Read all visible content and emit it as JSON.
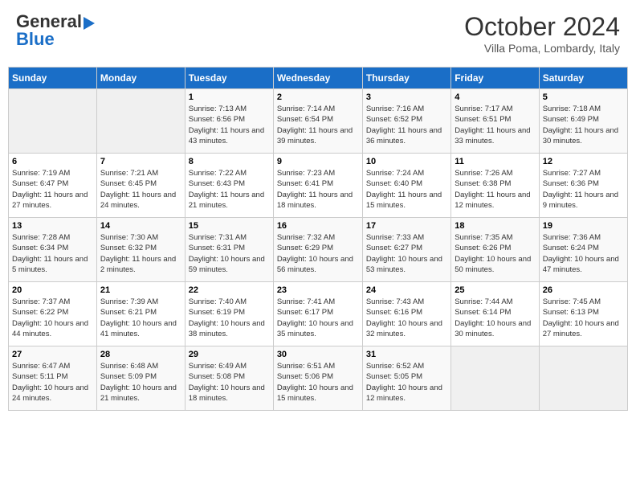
{
  "header": {
    "logo_line1": "General",
    "logo_line2": "Blue",
    "month": "October 2024",
    "location": "Villa Poma, Lombardy, Italy"
  },
  "days_of_week": [
    "Sunday",
    "Monday",
    "Tuesday",
    "Wednesday",
    "Thursday",
    "Friday",
    "Saturday"
  ],
  "weeks": [
    [
      {
        "day": "",
        "info": ""
      },
      {
        "day": "",
        "info": ""
      },
      {
        "day": "1",
        "info": "Sunrise: 7:13 AM\nSunset: 6:56 PM\nDaylight: 11 hours and 43 minutes."
      },
      {
        "day": "2",
        "info": "Sunrise: 7:14 AM\nSunset: 6:54 PM\nDaylight: 11 hours and 39 minutes."
      },
      {
        "day": "3",
        "info": "Sunrise: 7:16 AM\nSunset: 6:52 PM\nDaylight: 11 hours and 36 minutes."
      },
      {
        "day": "4",
        "info": "Sunrise: 7:17 AM\nSunset: 6:51 PM\nDaylight: 11 hours and 33 minutes."
      },
      {
        "day": "5",
        "info": "Sunrise: 7:18 AM\nSunset: 6:49 PM\nDaylight: 11 hours and 30 minutes."
      }
    ],
    [
      {
        "day": "6",
        "info": "Sunrise: 7:19 AM\nSunset: 6:47 PM\nDaylight: 11 hours and 27 minutes."
      },
      {
        "day": "7",
        "info": "Sunrise: 7:21 AM\nSunset: 6:45 PM\nDaylight: 11 hours and 24 minutes."
      },
      {
        "day": "8",
        "info": "Sunrise: 7:22 AM\nSunset: 6:43 PM\nDaylight: 11 hours and 21 minutes."
      },
      {
        "day": "9",
        "info": "Sunrise: 7:23 AM\nSunset: 6:41 PM\nDaylight: 11 hours and 18 minutes."
      },
      {
        "day": "10",
        "info": "Sunrise: 7:24 AM\nSunset: 6:40 PM\nDaylight: 11 hours and 15 minutes."
      },
      {
        "day": "11",
        "info": "Sunrise: 7:26 AM\nSunset: 6:38 PM\nDaylight: 11 hours and 12 minutes."
      },
      {
        "day": "12",
        "info": "Sunrise: 7:27 AM\nSunset: 6:36 PM\nDaylight: 11 hours and 9 minutes."
      }
    ],
    [
      {
        "day": "13",
        "info": "Sunrise: 7:28 AM\nSunset: 6:34 PM\nDaylight: 11 hours and 5 minutes."
      },
      {
        "day": "14",
        "info": "Sunrise: 7:30 AM\nSunset: 6:32 PM\nDaylight: 11 hours and 2 minutes."
      },
      {
        "day": "15",
        "info": "Sunrise: 7:31 AM\nSunset: 6:31 PM\nDaylight: 10 hours and 59 minutes."
      },
      {
        "day": "16",
        "info": "Sunrise: 7:32 AM\nSunset: 6:29 PM\nDaylight: 10 hours and 56 minutes."
      },
      {
        "day": "17",
        "info": "Sunrise: 7:33 AM\nSunset: 6:27 PM\nDaylight: 10 hours and 53 minutes."
      },
      {
        "day": "18",
        "info": "Sunrise: 7:35 AM\nSunset: 6:26 PM\nDaylight: 10 hours and 50 minutes."
      },
      {
        "day": "19",
        "info": "Sunrise: 7:36 AM\nSunset: 6:24 PM\nDaylight: 10 hours and 47 minutes."
      }
    ],
    [
      {
        "day": "20",
        "info": "Sunrise: 7:37 AM\nSunset: 6:22 PM\nDaylight: 10 hours and 44 minutes."
      },
      {
        "day": "21",
        "info": "Sunrise: 7:39 AM\nSunset: 6:21 PM\nDaylight: 10 hours and 41 minutes."
      },
      {
        "day": "22",
        "info": "Sunrise: 7:40 AM\nSunset: 6:19 PM\nDaylight: 10 hours and 38 minutes."
      },
      {
        "day": "23",
        "info": "Sunrise: 7:41 AM\nSunset: 6:17 PM\nDaylight: 10 hours and 35 minutes."
      },
      {
        "day": "24",
        "info": "Sunrise: 7:43 AM\nSunset: 6:16 PM\nDaylight: 10 hours and 32 minutes."
      },
      {
        "day": "25",
        "info": "Sunrise: 7:44 AM\nSunset: 6:14 PM\nDaylight: 10 hours and 30 minutes."
      },
      {
        "day": "26",
        "info": "Sunrise: 7:45 AM\nSunset: 6:13 PM\nDaylight: 10 hours and 27 minutes."
      }
    ],
    [
      {
        "day": "27",
        "info": "Sunrise: 6:47 AM\nSunset: 5:11 PM\nDaylight: 10 hours and 24 minutes."
      },
      {
        "day": "28",
        "info": "Sunrise: 6:48 AM\nSunset: 5:09 PM\nDaylight: 10 hours and 21 minutes."
      },
      {
        "day": "29",
        "info": "Sunrise: 6:49 AM\nSunset: 5:08 PM\nDaylight: 10 hours and 18 minutes."
      },
      {
        "day": "30",
        "info": "Sunrise: 6:51 AM\nSunset: 5:06 PM\nDaylight: 10 hours and 15 minutes."
      },
      {
        "day": "31",
        "info": "Sunrise: 6:52 AM\nSunset: 5:05 PM\nDaylight: 10 hours and 12 minutes."
      },
      {
        "day": "",
        "info": ""
      },
      {
        "day": "",
        "info": ""
      }
    ]
  ]
}
